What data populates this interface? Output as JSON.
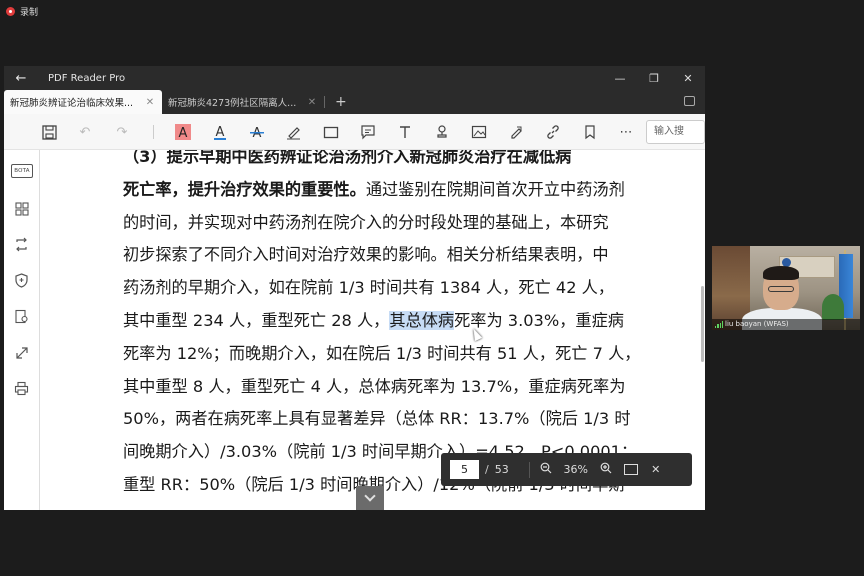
{
  "recorder": {
    "label": "录制",
    "dot_color": "#e03c3c"
  },
  "window": {
    "title": "PDF Reader Pro",
    "tabs": [
      {
        "label": "新冠肺炎辨证论治临床效果...",
        "active": true
      },
      {
        "label": "新冠肺炎4273例社区隔离人...",
        "active": false
      }
    ],
    "new_tab_symbol": "+"
  },
  "toolbar": {
    "icons": [
      "save-icon",
      "undo-icon",
      "redo-icon",
      "highlight-text-icon",
      "text-color-icon",
      "strikethrough-icon",
      "freehand-icon",
      "rectangle-icon",
      "comment-icon",
      "text-box-icon",
      "stamp-icon",
      "image-icon",
      "signature-icon",
      "link-icon",
      "bookmark-icon",
      "more-icon"
    ],
    "search_placeholder": "输入搜",
    "highlight_color": "#e84c4c"
  },
  "sidebar": {
    "bota_label": "BOTA",
    "icons": [
      "thumbnails-icon",
      "convert-icon",
      "security-icon",
      "settings-icon",
      "fullscreen-icon",
      "print-icon"
    ]
  },
  "document": {
    "lines": [
      {
        "bold": "（3）提示早期中医药辨证论治汤剂介入新冠肺炎治疗在减低病",
        "rest": "",
        "first": true
      },
      {
        "bold": "死亡率，提升治疗效果的重要性。",
        "rest": "通过鉴别在院期间首次开立中药汤剂"
      },
      {
        "bold": "",
        "rest": "的时间，并实现对中药汤剂在院介入的分时段处理的基础上，本研究"
      },
      {
        "bold": "",
        "rest": "初步探索了不同介入时间对治疗效果的影响。相关分析结果表明，中"
      },
      {
        "bold": "",
        "rest": "药汤剂的早期介入，如在院前 1/3 时间共有 1384 人，死亡 42 人，"
      },
      {
        "bold": "",
        "pre": "其中重型 234 人，重型死亡 28 人，",
        "hl": "其总体病",
        "rest": "死率为 3.03%，重症病"
      },
      {
        "bold": "",
        "rest": "死率为 12%；而晚期介入，如在院后 1/3 时间共有 51 人，死亡 7 人，"
      },
      {
        "bold": "",
        "rest": "其中重型 8 人，重型死亡 4 人，总体病死率为 13.7%，重症病死率为"
      },
      {
        "bold": "",
        "rest": "50%，两者在病死率上具有显著差异（总体 RR：13.7%（院后 1/3 时"
      },
      {
        "bold": "",
        "rest": "间晚期介入）/3.03%（院前 1/3 时间早期介入）=4.52，P<0.0001；"
      },
      {
        "bold": "",
        "rest": "重型 RR：50%（院后 1/3 时间晚期介入）/12%（院前 1/3 时间早期"
      }
    ]
  },
  "pager": {
    "current": "5",
    "separator": "/",
    "total": "53",
    "zoom": "36%"
  },
  "video": {
    "participant": "liu baoyan (WFAS)"
  }
}
